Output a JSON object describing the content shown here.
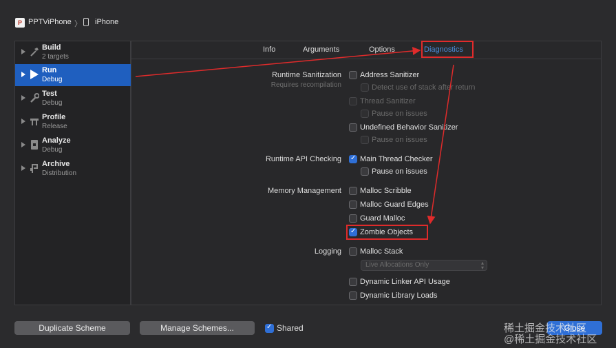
{
  "header": {
    "app_icon_letter": "P",
    "project": "PPTViPhone",
    "separator": "〉",
    "device": "iPhone"
  },
  "sidebar": {
    "items": [
      {
        "title": "Build",
        "subtitle": "2 targets"
      },
      {
        "title": "Run",
        "subtitle": "Debug"
      },
      {
        "title": "Test",
        "subtitle": "Debug"
      },
      {
        "title": "Profile",
        "subtitle": "Release"
      },
      {
        "title": "Analyze",
        "subtitle": "Debug"
      },
      {
        "title": "Archive",
        "subtitle": "Distribution"
      }
    ]
  },
  "tabs": [
    "Info",
    "Arguments",
    "Options",
    "Diagnostics"
  ],
  "active_tab": "Diagnostics",
  "sections": {
    "runtime_sanitization": {
      "label": "Runtime Sanitization",
      "sublabel": "Requires recompilation",
      "address_sanitizer": "Address Sanitizer",
      "detect_stack": "Detect use of stack after return",
      "thread_sanitizer": "Thread Sanitizer",
      "pause_on_issues_1": "Pause on issues",
      "undefined_behavior": "Undefined Behavior Sanitizer",
      "pause_on_issues_2": "Pause on issues"
    },
    "runtime_api": {
      "label": "Runtime API Checking",
      "main_thread_checker": "Main Thread Checker",
      "pause_on_issues": "Pause on issues"
    },
    "memory": {
      "label": "Memory Management",
      "malloc_scribble": "Malloc Scribble",
      "malloc_guard_edges": "Malloc Guard Edges",
      "guard_malloc": "Guard Malloc",
      "zombie_objects": "Zombie Objects"
    },
    "logging": {
      "label": "Logging",
      "malloc_stack": "Malloc Stack",
      "live_allocations": "Live Allocations Only",
      "dynamic_linker": "Dynamic Linker API Usage",
      "dynamic_library": "Dynamic Library Loads"
    }
  },
  "checked": {
    "main_thread_checker": true,
    "zombie_objects": true,
    "shared": true
  },
  "footer": {
    "duplicate": "Duplicate Scheme",
    "manage": "Manage Schemes...",
    "shared": "Shared",
    "close": "Close"
  },
  "watermark": {
    "line1": "稀土掘金技术社区",
    "line2": "@稀土掘金技术社区"
  },
  "colors": {
    "accent": "#2f6fd6",
    "selection": "#1f5fbf",
    "annotation_red": "#e02b2b"
  }
}
